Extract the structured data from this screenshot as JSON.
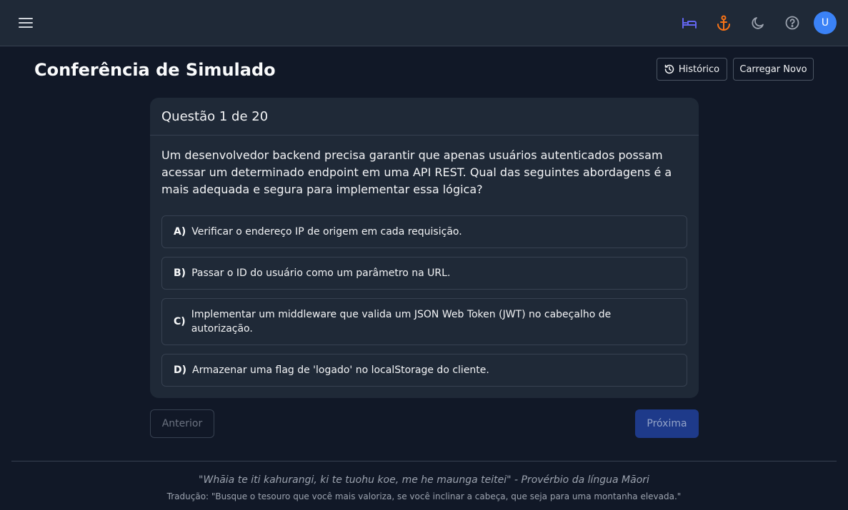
{
  "header": {
    "menu_icon": "menu-icon",
    "icons": [
      {
        "name": "bed-icon",
        "color": "#6366f1"
      },
      {
        "name": "anchor-icon",
        "color": "#f97316"
      },
      {
        "name": "moon-icon",
        "color": "#9ca3af"
      },
      {
        "name": "help-icon",
        "color": "#9ca3af"
      }
    ],
    "avatar_initial": "U",
    "avatar_color": "#3b82f6"
  },
  "page": {
    "title": "Conferência de Simulado",
    "history_label": "Histórico",
    "history_icon": "history-icon",
    "load_label": "Carregar Novo"
  },
  "question": {
    "counter": "Questão 1 de 20",
    "text": "Um desenvolvedor backend precisa garantir que apenas usuários autenticados possam acessar um determinado endpoint em uma API REST. Qual das seguintes abordagens é a mais adequada e segura para implementar essa lógica?",
    "options": [
      {
        "letter": "A)",
        "text": "Verificar o endereço IP de origem em cada requisição."
      },
      {
        "letter": "B)",
        "text": "Passar o ID do usuário como um parâmetro na URL."
      },
      {
        "letter": "C)",
        "text": "Implementar um middleware que valida um JSON Web Token (JWT) no cabeçalho de autorização."
      },
      {
        "letter": "D)",
        "text": "Armazenar uma flag de 'logado' no localStorage do cliente."
      }
    ]
  },
  "navigation": {
    "previous_label": "Anterior",
    "next_label": "Próxima"
  },
  "footer": {
    "quote": "\"Whāia te iti kahurangi, ki te tuohu koe, me he maunga teitei\" - Provérbio da língua Māori",
    "translation": "Tradução: \"Busque o tesouro que você mais valoriza, se você inclinar a cabeça, que seja para uma montanha elevada.\""
  }
}
